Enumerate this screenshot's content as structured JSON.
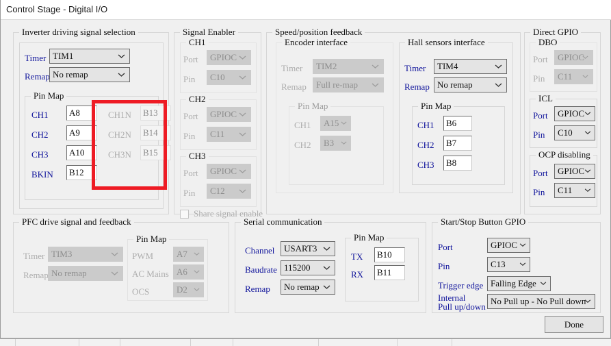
{
  "window": {
    "title": "Control Stage - Digital I/O",
    "done_label": "Done"
  },
  "inverter": {
    "title": "Inverter driving signal selection",
    "timer_label": "Timer",
    "timer_value": "TIM1",
    "remap_label": "Remap",
    "remap_value": "No remap",
    "pinmap_title": "Pin Map",
    "rows": [
      {
        "label": "CH1",
        "value": "A8"
      },
      {
        "label": "CH2",
        "value": "A9"
      },
      {
        "label": "CH3",
        "value": "A10"
      },
      {
        "label": "BKIN",
        "value": "B12"
      }
    ],
    "n_rows": [
      {
        "label": "CH1N",
        "value": "B13"
      },
      {
        "label": "CH2N",
        "value": "B14"
      },
      {
        "label": "CH3N",
        "value": "B15"
      }
    ]
  },
  "signal_enabler": {
    "title": "Signal Enabler",
    "port_label": "Port",
    "pin_label": "Pin",
    "channels": [
      {
        "title": "CH1",
        "port": "GPIOC",
        "pin": "C10"
      },
      {
        "title": "CH2",
        "port": "GPIOC",
        "pin": "C11"
      },
      {
        "title": "CH3",
        "port": "GPIOC",
        "pin": "C12"
      }
    ],
    "share_label": "Share signal enable",
    "share_checked": false
  },
  "speed_feedback": {
    "title": "Speed/position feedback",
    "encoder": {
      "title": "Encoder interface",
      "timer_label": "Timer",
      "timer_value": "TIM2",
      "remap_label": "Remap",
      "remap_value": "Full re-map",
      "pinmap_title": "Pin Map",
      "rows": [
        {
          "label": "CH1",
          "value": "A15"
        },
        {
          "label": "CH2",
          "value": "B3"
        }
      ]
    },
    "hall": {
      "title": "Hall sensors interface",
      "timer_label": "Timer",
      "timer_value": "TIM4",
      "remap_label": "Remap",
      "remap_value": "No remap",
      "pinmap_title": "Pin Map",
      "rows": [
        {
          "label": "CH1",
          "value": "B6"
        },
        {
          "label": "CH2",
          "value": "B7"
        },
        {
          "label": "CH3",
          "value": "B8"
        }
      ]
    }
  },
  "direct_gpio": {
    "title": "Direct GPIO",
    "port_label": "Port",
    "pin_label": "Pin",
    "groups": [
      {
        "title": "DBO",
        "port": "GPIOC",
        "pin": "C11"
      },
      {
        "title": "ICL",
        "port": "GPIOC",
        "pin": "C10"
      },
      {
        "title": "OCP disabling",
        "port": "GPIOC",
        "pin": "C11"
      }
    ]
  },
  "pfc": {
    "title": "PFC drive signal and feedback",
    "timer_label": "Timer",
    "timer_value": "TIM3",
    "remap_label": "Remap",
    "remap_value": "No remap",
    "pinmap_title": "Pin Map",
    "rows": [
      {
        "label": "PWM",
        "value": "A7"
      },
      {
        "label": "AC Mains",
        "value": "A6"
      },
      {
        "label": "OCS",
        "value": "D2"
      }
    ]
  },
  "serial": {
    "title": "Serial communication",
    "channel_label": "Channel",
    "channel_value": "USART3",
    "baudrate_label": "Baudrate",
    "baudrate_value": "115200",
    "remap_label": "Remap",
    "remap_value": "No remap",
    "pinmap_title": "Pin Map",
    "rows": [
      {
        "label": "TX",
        "value": "B10"
      },
      {
        "label": "RX",
        "value": "B11"
      }
    ]
  },
  "start_stop": {
    "title": "Start/Stop Button GPIO",
    "port_label": "Port",
    "port_value": "GPIOC",
    "pin_label": "Pin",
    "pin_value": "C13",
    "trigger_label": "Trigger edge",
    "trigger_value": "Falling Edge",
    "pull_label_line1": "Internal",
    "pull_label_line2": "Pull up/down",
    "pull_value": "No Pull up - No Pull down"
  },
  "colors": {
    "label_blue": "#10149b",
    "disabled_grey": "#adadad",
    "highlight_red": "#ee1b24",
    "window_bg": "#f0f0f0"
  }
}
